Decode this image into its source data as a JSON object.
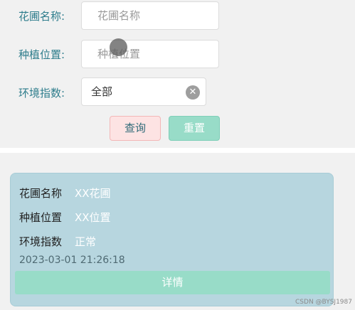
{
  "filters": {
    "garden_name_label": "花圃名称:",
    "garden_name_placeholder": "花圃名称",
    "planting_location_label": "种植位置:",
    "planting_location_placeholder": "种植位置",
    "environment_index_label": "环境指数:",
    "environment_index_value": "全部",
    "query_button": "查询",
    "reset_button": "重置"
  },
  "card": {
    "fields": [
      {
        "label": "花圃名称",
        "value": "XX花圃"
      },
      {
        "label": "种植位置",
        "value": "XX位置"
      },
      {
        "label": "环境指数",
        "value": "正常"
      }
    ],
    "timestamp": "2023-03-01 21:26:18",
    "detail_button": "详情"
  },
  "watermark": "CSDN @BYSJ1987",
  "icons": {
    "clear": "close-circle-icon"
  },
  "colors": {
    "accent": "#98dcc8",
    "label": "#2e7d8c",
    "card_bg": "#b7d6df"
  }
}
